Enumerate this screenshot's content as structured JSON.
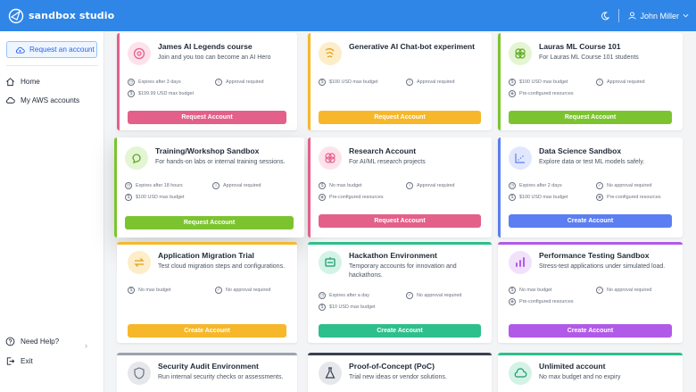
{
  "app": {
    "title": "sandbox studio"
  },
  "header": {
    "user_name": "John Miller"
  },
  "sidebar": {
    "request_label": "Request an account",
    "items": [
      {
        "label": "Home",
        "icon": "home-icon"
      },
      {
        "label": "My AWS accounts",
        "icon": "cloud-icon"
      }
    ],
    "bottom": [
      {
        "label": "Need Help?",
        "icon": "help-icon"
      },
      {
        "label": "Exit",
        "icon": "exit-icon"
      }
    ]
  },
  "cards": [
    {
      "title": "James AI Legends course",
      "desc": "Join and you too can become an AI Hero",
      "accent": "#e3608b",
      "icon_bg": "#fde2ec",
      "icon": "robot-icon",
      "meta": [
        "Expires after 3 days",
        "Approval required",
        "$199.99 USD max budget"
      ],
      "button": "Request Account"
    },
    {
      "title": "Generative AI Chat-bot experiment",
      "desc": "",
      "accent": "#f6b82a",
      "icon_bg": "#fdedc8",
      "icon": "chat-icon",
      "meta": [
        "$100 USD max budget",
        "Approval required"
      ],
      "button": "Request Account"
    },
    {
      "title": "Lauras ML Course 101",
      "desc": "For Lauras ML Course 101 students",
      "accent": "#7cc42f",
      "icon_bg": "#e3f5d2",
      "icon": "brain-icon",
      "meta": [
        "$100 USD max budget",
        "Approval required",
        "Pre-configured resources"
      ],
      "button": "Request Account"
    },
    {
      "title": "Training/Workshop Sandbox",
      "desc": "For hands-on labs or internal training sessions.",
      "accent": "#7cc42f",
      "icon_bg": "#e3f5d2",
      "icon": "workshop-icon",
      "meta": [
        "Expires after 18 hours",
        "Approval required",
        "$100 USD max budget"
      ],
      "button": "Request Account"
    },
    {
      "title": "Research Account",
      "desc": "For AI/ML research projects",
      "accent": "#e3608b",
      "icon_bg": "#fde2ec",
      "icon": "research-icon",
      "meta": [
        "No max budget",
        "Approval required",
        "Pre-configured resources"
      ],
      "button": "Request Account"
    },
    {
      "title": "Data Science Sandbox",
      "desc": "Explore data or test ML models safely.",
      "accent": "#5b7ef2",
      "icon_bg": "#e1e8fd",
      "icon": "chart-icon",
      "meta": [
        "Expires after 2 days",
        "No approval required",
        "$100 USD max budget",
        "Pre-configured resources"
      ],
      "button": "Create Account"
    },
    {
      "title": "Application Migration Trial",
      "desc": "Test cloud migration steps and configurations.",
      "accent": "#f6b82a",
      "icon_bg": "#fdedc8",
      "icon": "migrate-icon",
      "meta": [
        "No max budget",
        "No approval required"
      ],
      "button": "Create Account"
    },
    {
      "title": "Hackathon Environment",
      "desc": "Temporary accounts for innovation and hackathons.",
      "accent": "#2dbf8c",
      "icon_bg": "#d3f3e6",
      "icon": "hackathon-icon",
      "meta": [
        "Expires after a day",
        "No approval required",
        "$10 USD max budget"
      ],
      "button": "Create Account"
    },
    {
      "title": "Performance Testing Sandbox",
      "desc": "Stress-test applications under simulated load.",
      "accent": "#b15ae8",
      "icon_bg": "#f1e1fb",
      "icon": "performance-icon",
      "meta": [
        "No max budget",
        "No approval required",
        "Pre-configured resources"
      ],
      "button": "Create Account"
    },
    {
      "title": "Security Audit Environment",
      "desc": "Run internal security checks or assessments.",
      "accent": "#9ca3af",
      "icon_bg": "#e5e7eb",
      "icon": "shield-icon",
      "meta": [],
      "button": ""
    },
    {
      "title": "Proof-of-Concept (PoC)",
      "desc": "Trial new ideas or vendor solutions.",
      "accent": "#374151",
      "icon_bg": "#e5e7eb",
      "icon": "flask-icon",
      "meta": [],
      "button": ""
    },
    {
      "title": "Unlimited account",
      "desc": "No max budget and no expiry",
      "accent": "#2dbf8c",
      "icon_bg": "#d3f3e6",
      "icon": "cloud-icon",
      "meta": [],
      "button": ""
    }
  ]
}
